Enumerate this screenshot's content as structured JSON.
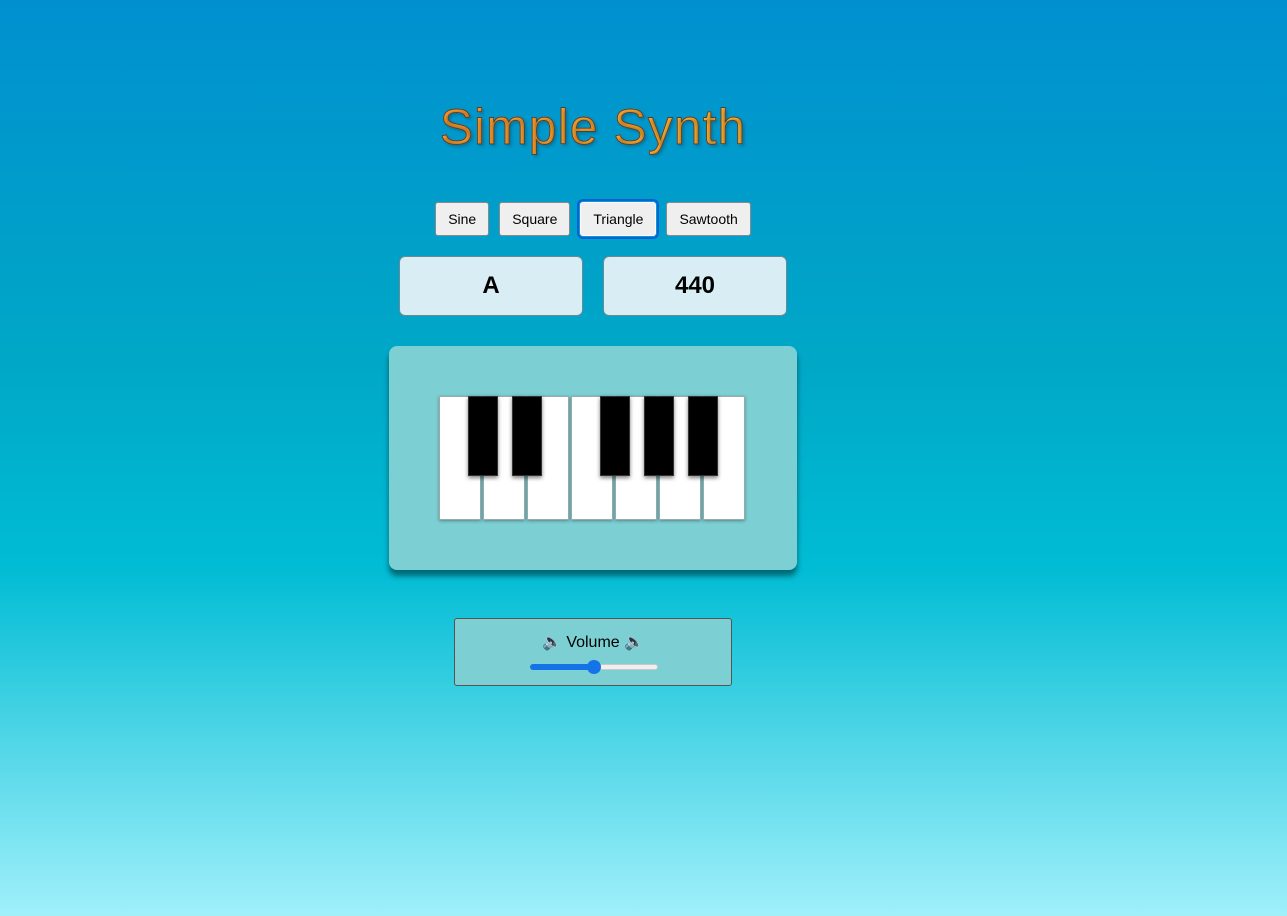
{
  "header": {
    "title": "Simple Synth"
  },
  "waveforms": {
    "active": "Triangle",
    "buttons": [
      {
        "id": "sine",
        "label": "Sine"
      },
      {
        "id": "square",
        "label": "Square"
      },
      {
        "id": "triangle",
        "label": "Triangle"
      },
      {
        "id": "sawtooth",
        "label": "Sawtooth"
      }
    ]
  },
  "display": {
    "note": "A",
    "frequency": "440"
  },
  "keyboard": {
    "white_keys": 7,
    "black_keys": 5
  },
  "volume": {
    "label": "Volume",
    "left_icon": "speaker-icon",
    "right_icon": "speaker-icon",
    "level": 0.5
  },
  "colors": {
    "accent": "#1473e6",
    "title_gradient_start": "#ff7a2a",
    "title_gradient_end": "#ffe23a"
  }
}
